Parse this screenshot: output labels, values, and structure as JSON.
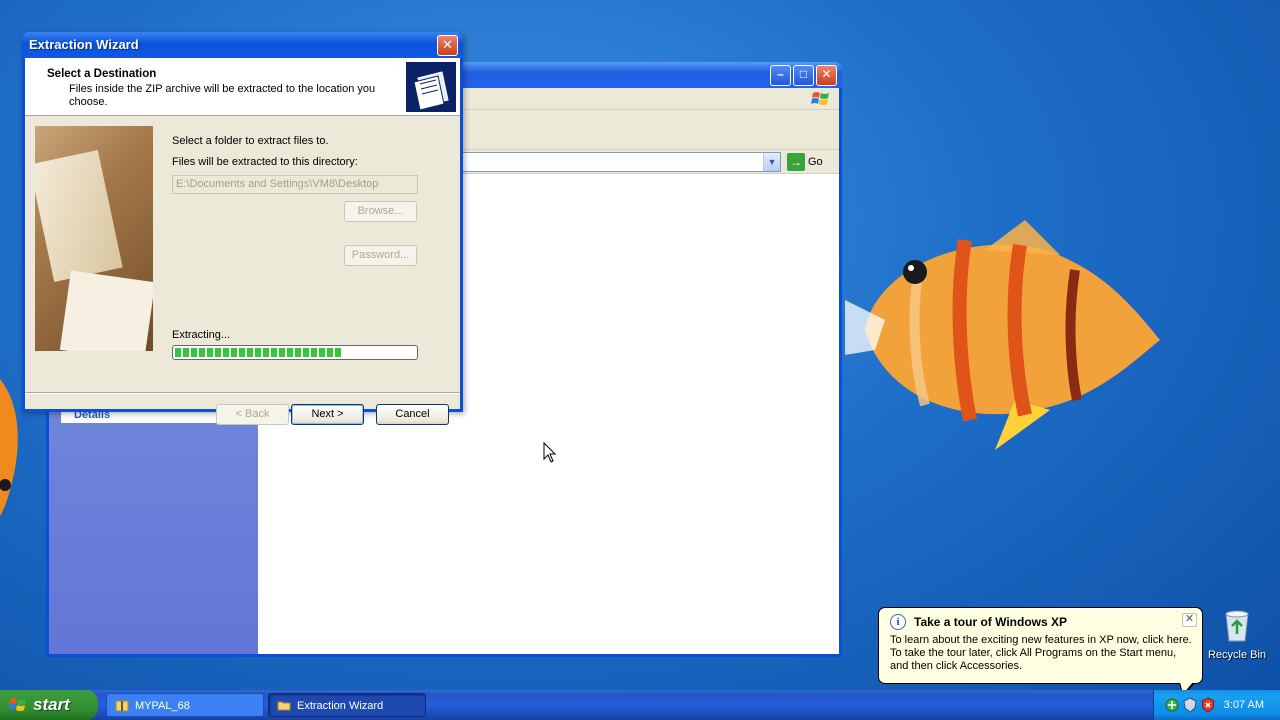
{
  "wizard": {
    "title": "Extraction Wizard",
    "close_label": "✕",
    "header_title": "Select a Destination",
    "header_subtitle": "Files inside the ZIP archive will be extracted to the location you choose.",
    "select_folder_label": "Select a folder to extract files to.",
    "directory_label": "Files will be extracted to this directory:",
    "path_value": "E:\\Documents and Settings\\VM8\\Desktop",
    "browse_label": "Browse...",
    "password_label": "Password...",
    "extracting_label": "Extracting...",
    "progress_fraction": 0.69,
    "back_label": "< Back",
    "next_label": "Next >",
    "cancel_label": "Cancel"
  },
  "explorer": {
    "go_label": "Go",
    "details_label": "Details"
  },
  "balloon": {
    "title": "Take a tour of Windows XP",
    "text": "To learn about the exciting new features in XP now, click here. To take the tour later, click All Programs on the Start menu, and then click Accessories.",
    "close_label": "✕"
  },
  "desktop": {
    "recycle_bin_label": "Recycle Bin"
  },
  "taskbar": {
    "start_label": "start",
    "tasks": [
      {
        "label": "MYPAL_68",
        "icon": "zip-folder-icon",
        "active": false
      },
      {
        "label": "Extraction Wizard",
        "icon": "folder-icon",
        "active": true
      }
    ],
    "clock": "3:07 AM"
  },
  "colors": {
    "xp_blue": "#0a4fd8",
    "start_green": "#3a9a3a",
    "progress_green": "#39c53a",
    "balloon_bg": "#ffffe1"
  }
}
